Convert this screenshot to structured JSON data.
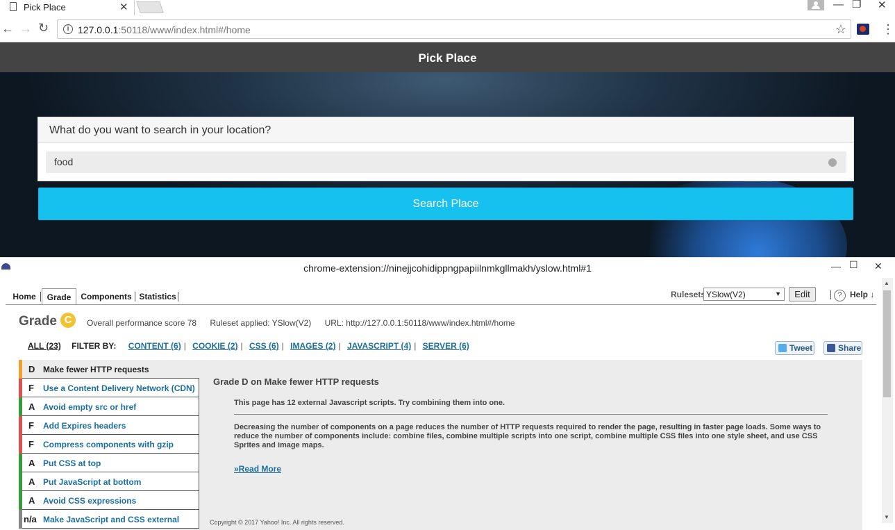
{
  "browser": {
    "tab_title": "Pick Place",
    "tab_close": "✕",
    "url_host": "127.0.0.1",
    "url_rest": ":50118/www/index.html#/home"
  },
  "app": {
    "header_title": "Pick Place",
    "search_prompt": "What do you want to search in your location?",
    "search_value": "food",
    "search_button": "Search Place"
  },
  "yslow": {
    "window_title": "chrome-extension://ninejjcohidippngpapiilnmkgllmakh/yslow.html#1",
    "tabs": [
      "Home",
      "Grade",
      "Components",
      "Statistics"
    ],
    "active_tab": "Grade",
    "rulesets_label": "Rulesets",
    "ruleset_selected": "YSlow(V2)",
    "edit_label": "Edit",
    "help_label": "Help ↓",
    "grade_label": "Grade",
    "grade": "C",
    "score_text": "Overall performance score 78",
    "ruleset_text": "Ruleset applied: YSlow(V2)",
    "url_text": "URL: http://127.0.0.1:50118/www/index.html#/home",
    "filter_all": "ALL (23)",
    "filter_by": "FILTER BY:",
    "filters": [
      "CONTENT (6)",
      "COOKIE (2)",
      "CSS (6)",
      "IMAGES (2)",
      "JAVASCRIPT (4)",
      "SERVER (6)"
    ],
    "tweet_label": "Tweet",
    "share_label": "Share",
    "rules": [
      {
        "grade": "D",
        "text": "Make fewer HTTP requests",
        "color": "#f0a030"
      },
      {
        "grade": "F",
        "text": "Use a Content Delivery Network (CDN)",
        "color": "#d9534f"
      },
      {
        "grade": "A",
        "text": "Avoid empty src or href",
        "color": "#3a9a3a"
      },
      {
        "grade": "F",
        "text": "Add Expires headers",
        "color": "#d9534f"
      },
      {
        "grade": "F",
        "text": "Compress components with gzip",
        "color": "#d9534f"
      },
      {
        "grade": "A",
        "text": "Put CSS at top",
        "color": "#3a9a3a"
      },
      {
        "grade": "A",
        "text": "Put JavaScript at bottom",
        "color": "#3a9a3a"
      },
      {
        "grade": "A",
        "text": "Avoid CSS expressions",
        "color": "#3a9a3a"
      },
      {
        "grade": "n/a",
        "text": "Make JavaScript and CSS external",
        "color": "#888888"
      }
    ],
    "detail_title": "Grade D on Make fewer HTTP requests",
    "detail_message": "This page has 12 external Javascript scripts. Try combining them into one.",
    "detail_description": "Decreasing the number of components on a page reduces the number of HTTP requests required to render the page, resulting in faster page loads. Some ways to reduce the number of components include: combine files, combine multiple scripts into one script, combine multiple CSS files into one style sheet, and use CSS Sprites and image maps.",
    "read_more": "»Read More",
    "copyright": "Copyright © 2017 Yahoo! Inc. All rights reserved."
  }
}
